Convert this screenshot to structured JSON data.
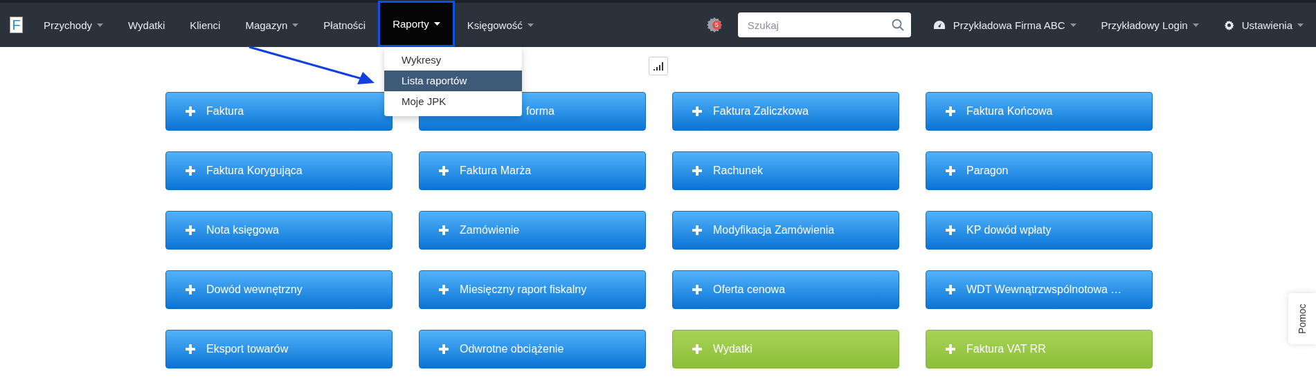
{
  "navbar": {
    "logo": "F",
    "items": [
      {
        "label": "Przychody",
        "caret": true,
        "selected": false,
        "highlighted": false
      },
      {
        "label": "Wydatki",
        "caret": false,
        "selected": false,
        "highlighted": false
      },
      {
        "label": "Klienci",
        "caret": false,
        "selected": false,
        "highlighted": false
      },
      {
        "label": "Magazyn",
        "caret": true,
        "selected": false,
        "highlighted": false
      },
      {
        "label": "Płatności",
        "caret": false,
        "selected": false,
        "highlighted": false
      },
      {
        "label": "Raporty",
        "caret": true,
        "selected": true,
        "highlighted": true
      },
      {
        "label": "Księgowość",
        "caret": true,
        "selected": false,
        "highlighted": false
      }
    ],
    "notification_badge": "5",
    "search": {
      "placeholder": "Szukaj"
    },
    "company": "Przykładowa Firma ABC",
    "login": "Przykładowy Login",
    "settings": "Ustawienia"
  },
  "dropdown": {
    "items": [
      {
        "label": "Wykresy",
        "selected": false
      },
      {
        "label": "Lista raportów",
        "selected": true
      },
      {
        "label": "Moje JPK",
        "selected": false
      }
    ]
  },
  "buttons": [
    {
      "label": "Faktura",
      "kind": "blue",
      "covered": false
    },
    {
      "label": "forma",
      "kind": "blue",
      "covered": true
    },
    {
      "label": "Faktura Zaliczkowa",
      "kind": "blue",
      "covered": false
    },
    {
      "label": "Faktura Końcowa",
      "kind": "blue",
      "covered": false
    },
    {
      "label": "Faktura Korygująca",
      "kind": "blue",
      "covered": false
    },
    {
      "label": "Faktura Marża",
      "kind": "blue",
      "covered": false
    },
    {
      "label": "Rachunek",
      "kind": "blue",
      "covered": false
    },
    {
      "label": "Paragon",
      "kind": "blue",
      "covered": false
    },
    {
      "label": "Nota księgowa",
      "kind": "blue",
      "covered": false
    },
    {
      "label": "Zamówienie",
      "kind": "blue",
      "covered": false
    },
    {
      "label": "Modyfikacja Zamówienia",
      "kind": "blue",
      "covered": false
    },
    {
      "label": "KP dowód wpłaty",
      "kind": "blue",
      "covered": false
    },
    {
      "label": "Dowód wewnętrzny",
      "kind": "blue",
      "covered": false
    },
    {
      "label": "Miesięczny raport fiskalny",
      "kind": "blue",
      "covered": false
    },
    {
      "label": "Oferta cenowa",
      "kind": "blue",
      "covered": false
    },
    {
      "label": "WDT Wewnątrzwspólnotowa …",
      "kind": "blue",
      "covered": false
    },
    {
      "label": "Eksport towarów",
      "kind": "blue",
      "covered": false
    },
    {
      "label": "Odwrotne obciążenie",
      "kind": "blue",
      "covered": false
    },
    {
      "label": "Wydatki",
      "kind": "green",
      "covered": false
    },
    {
      "label": "Faktura VAT RR",
      "kind": "green",
      "covered": false
    }
  ],
  "help_tab": "Pomoc"
}
